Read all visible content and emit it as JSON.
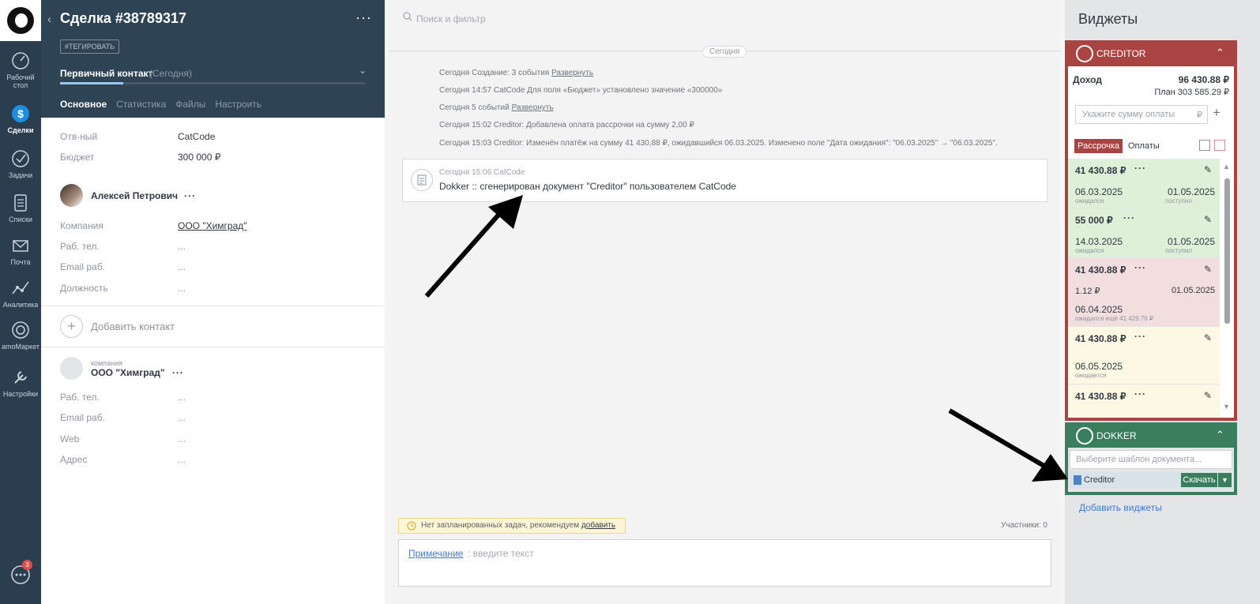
{
  "nav": {
    "items": [
      {
        "label": "Рабочий стол"
      },
      {
        "label": "Сделки"
      },
      {
        "label": "Задачи"
      },
      {
        "label": "Списки"
      },
      {
        "label": "Почта"
      },
      {
        "label": "Аналитика"
      },
      {
        "label": "amoМаркет"
      },
      {
        "label": "Настройки"
      }
    ],
    "chat_badge": "3"
  },
  "deal": {
    "title": "Сделка #38789317",
    "tag_button": "#ТЕГИРОВАТЬ",
    "stage": "Первичный контакт",
    "stage_date": "(Сегодня)",
    "tabs": [
      "Основное",
      "Статистика",
      "Файлы",
      "Настроить"
    ],
    "fields": [
      {
        "label": "Отв-ный",
        "value": "CatCode"
      },
      {
        "label": "Бюджет",
        "value": "300 000 ₽"
      }
    ],
    "contact": {
      "name": "Алексей Петрович",
      "fields": [
        {
          "label": "Компания",
          "value": "ООО \"Химград\""
        },
        {
          "label": "Раб. тел.",
          "value": "..."
        },
        {
          "label": "Email раб.",
          "value": "..."
        },
        {
          "label": "Должность",
          "value": "..."
        }
      ]
    },
    "add_contact": "Добавить контакт",
    "company": {
      "kind": "компания",
      "name": "ООО \"Химград\"",
      "fields": [
        {
          "label": "Раб. тел.",
          "value": "..."
        },
        {
          "label": "Email раб.",
          "value": "..."
        },
        {
          "label": "Web",
          "value": "..."
        },
        {
          "label": "Адрес",
          "value": "..."
        }
      ]
    }
  },
  "feed": {
    "search_placeholder": "Поиск и фильтр",
    "today_label": "Сегодня",
    "events": [
      {
        "text": "Сегодня Создание: 3 события ",
        "link": "Развернуть"
      },
      {
        "text": "Сегодня 14:57 CatCode Для поля «Бюджет» установлено значение «300000»",
        "link": ""
      },
      {
        "text": "Сегодня 5 событий ",
        "link": "Развернуть"
      },
      {
        "text": "Сегодня 15:02 Creditor: Добавлена оплата рассрочки на сумму 2,00 ₽",
        "link": ""
      },
      {
        "text": "Сегодня 15:03 Creditor: Изменён платёж на сумму 41 430,88 ₽, ожидавшийся 06.03.2025. Изменено поле \"Дата ожидания\": \"06.03.2025\" → \"06.03.2025\".",
        "link": ""
      }
    ],
    "note_meta": "Сегодня 15:06 CatCode",
    "note_text": "Dokker :: сгенерирован документ \"Creditor\" пользователем CatCode",
    "tasks_warning": "Нет запланированных задач, рекомендуем ",
    "tasks_link": "добавить",
    "participants": "Участники: 0",
    "composer_label": "Примечание",
    "composer_placeholder": ": введите текст"
  },
  "widgets": {
    "title": "Виджеты",
    "creditor": {
      "name": "CREDITOR",
      "income_label": "Доход",
      "income_value": "96 430.88 ₽",
      "plan": "План 303 585.29 ₽",
      "sum_placeholder": "Укажите сумму оплаты",
      "currency": "₽",
      "tab_installments": "Рассрочка",
      "tab_payments": "Оплаты",
      "payments": [
        {
          "amount": "41 430.88 ₽",
          "date1": "06.03.2025",
          "sub1": "ожидался",
          "date2": "01.05.2025",
          "sub2": "поступил",
          "color": "green"
        },
        {
          "amount": "55 000 ₽",
          "date1": "14.03.2025",
          "sub1": "ожидался",
          "date2": "01.05.2025",
          "sub2": "поступил",
          "color": "green"
        },
        {
          "amount": "41 430.88 ₽",
          "extra": "1.12 ₽",
          "extra_date": "01.05.2025",
          "date1": "06.04.2025",
          "sub1": "ожидался ещё 41 429.76 ₽",
          "color": "red"
        },
        {
          "amount": "41 430.88 ₽",
          "date1": "06.05.2025",
          "sub1": "ожидается",
          "color": "yellow"
        },
        {
          "amount": "41 430.88 ₽",
          "color": "yellow"
        }
      ]
    },
    "dokker": {
      "name": "DOKKER",
      "template_placeholder": "Выберите шаблон документа...",
      "file": "Creditor",
      "download": "Скачать"
    },
    "add_widgets": "Добавить виджеты"
  },
  "colors": {
    "rail": "#2b3e50",
    "deal_header": "#2e4354",
    "creditor": "#a94442",
    "dokker": "#3a7e5e",
    "link": "#4077d1"
  }
}
